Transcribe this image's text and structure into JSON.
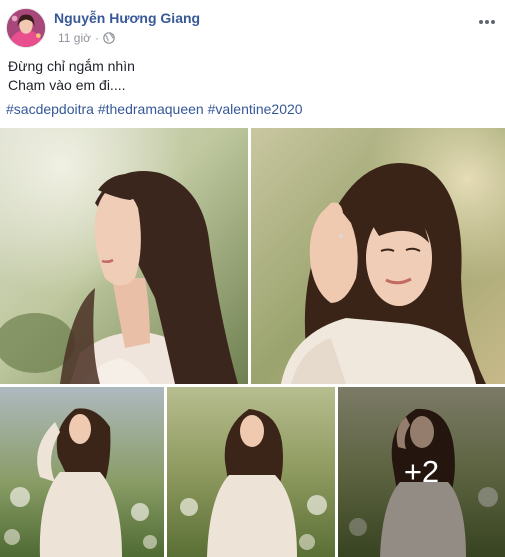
{
  "post": {
    "author": "Nguyễn Hương Giang",
    "time": "11 giờ",
    "privacy_icon": "globe-icon",
    "more_icon": "ellipsis-icon",
    "text_lines": [
      "Đừng chỉ ngắm nhìn",
      "Chạm vào em đi...."
    ],
    "hashtags": [
      "#sacdepdoitra",
      "#thedramaqueen",
      "#valentine2020"
    ]
  },
  "gallery": {
    "more_count": "+2"
  },
  "colors": {
    "link": "#385898",
    "meta": "#90949c",
    "text": "#1d2129"
  }
}
